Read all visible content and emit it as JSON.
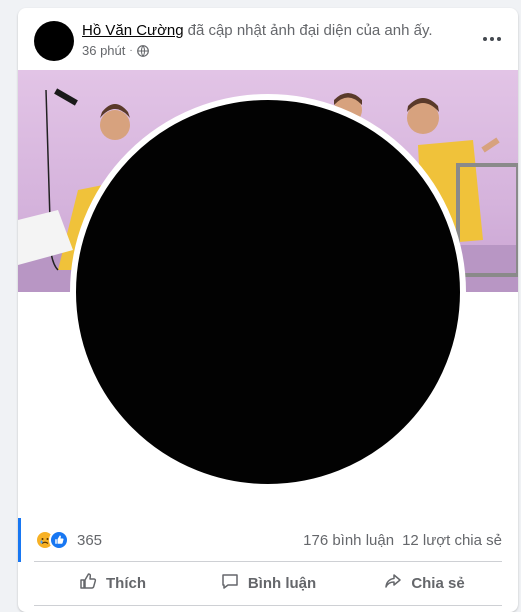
{
  "post": {
    "author": "Hồ Văn Cường",
    "action_text": "đã cập nhật ảnh đại diện của anh ấy.",
    "time": "36 phút",
    "separator": "·"
  },
  "icons": {
    "privacy": "globe-icon",
    "more": "more-options-icon"
  },
  "stats": {
    "reaction_count": "365",
    "comments": "176 bình luận",
    "shares": "12 lượt chia sẻ",
    "reactions": [
      "sad-reaction-icon",
      "like-reaction-icon"
    ]
  },
  "actions": {
    "like": "Thích",
    "comment": "Bình luận",
    "share": "Chia sẻ"
  },
  "colors": {
    "accent": "#1877f2",
    "secondary_text": "#65676b",
    "cover_bg": "#d5b3dc"
  }
}
